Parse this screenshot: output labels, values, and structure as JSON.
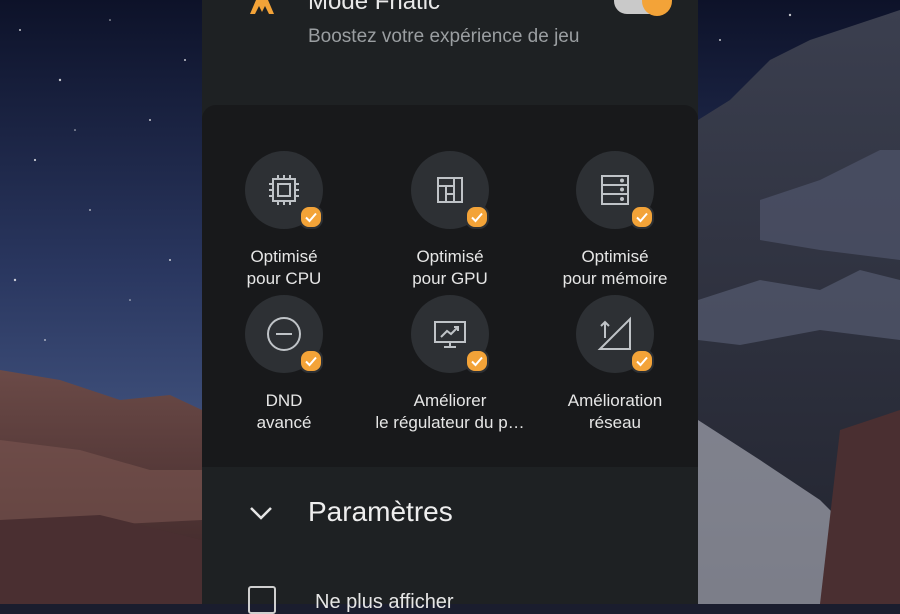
{
  "header": {
    "title": "Mode Fnatic",
    "subtitle": "Boostez votre expérience de jeu",
    "toggle_on": true
  },
  "optimizations": [
    {
      "line1": "Optimisé",
      "line2": "pour CPU",
      "icon": "cpu-icon",
      "checked": true
    },
    {
      "line1": "Optimisé",
      "line2": "pour GPU",
      "icon": "gpu-icon",
      "checked": true
    },
    {
      "line1": "Optimisé",
      "line2": "pour mémoire",
      "icon": "memory-icon",
      "checked": true
    },
    {
      "line1": "DND",
      "line2": "avancé",
      "icon": "dnd-icon",
      "checked": true
    },
    {
      "line1": "Améliorer",
      "line2": "le régulateur du p…",
      "icon": "monitor-chart-icon",
      "checked": true
    },
    {
      "line1": "Amélioration",
      "line2": "réseau",
      "icon": "network-signal-icon",
      "checked": true
    }
  ],
  "settings": {
    "label": "Paramètres"
  },
  "dont_show": {
    "label": "Ne plus afficher",
    "checked": false
  },
  "colors": {
    "accent": "#f3a338",
    "panel": "#1e2123",
    "card": "#18191b",
    "circle": "#2d3034"
  }
}
